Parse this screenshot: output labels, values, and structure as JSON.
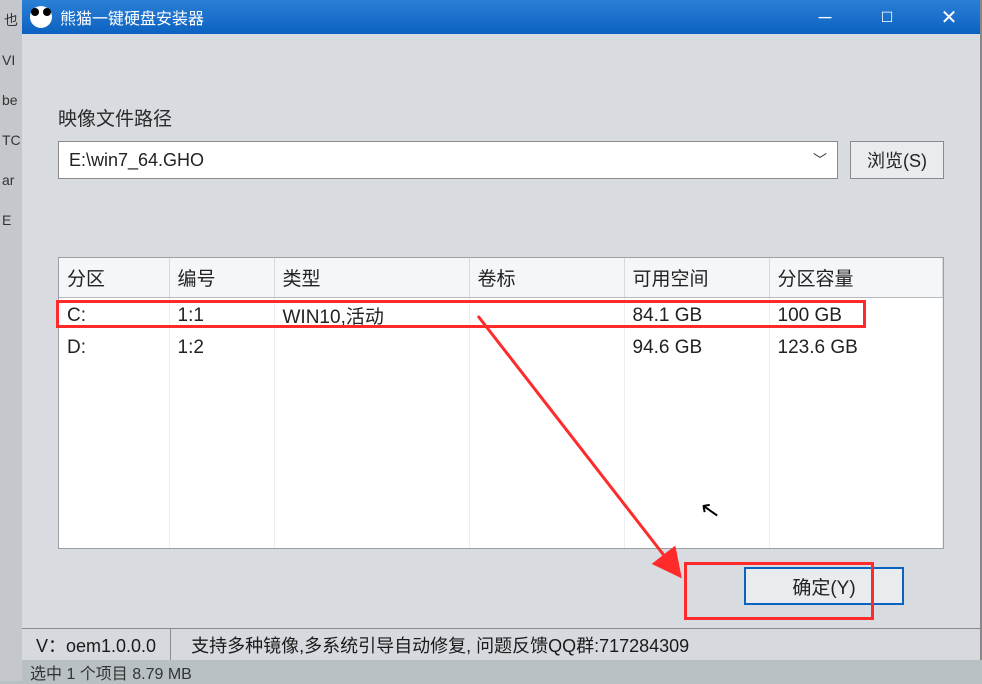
{
  "titlebar": {
    "title": "熊猫一键硬盘安装器"
  },
  "image_path": {
    "label": "映像文件路径",
    "value": "E:\\win7_64.GHO",
    "browse": "浏览(S)"
  },
  "table": {
    "headers": {
      "partition": "分区",
      "number": "编号",
      "type": "类型",
      "volume": "卷标",
      "available": "可用空间",
      "capacity": "分区容量"
    },
    "rows": [
      {
        "partition": "C:",
        "number": "1:1",
        "type": "WIN10,活动",
        "volume": "",
        "available": "84.1 GB",
        "capacity": "100 GB"
      },
      {
        "partition": "D:",
        "number": "1:2",
        "type": "",
        "volume": "",
        "available": "94.6 GB",
        "capacity": "123.6 GB"
      }
    ]
  },
  "footer": {
    "ok": "确定(Y)"
  },
  "status": {
    "version": "V：oem1.0.0.0",
    "info": "支持多种镜像,多系统引导自动修复, 问题反馈QQ群:717284309"
  },
  "below": "选中 1 个项目  8.79 MB"
}
